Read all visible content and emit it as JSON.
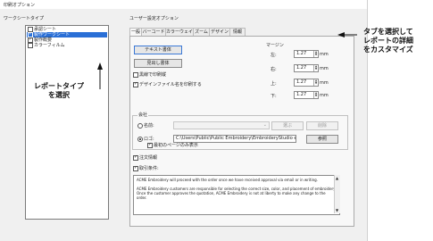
{
  "window_title": "印刷オプション",
  "report_types": {
    "label": "ワークシートタイプ",
    "items": [
      {
        "label": "承認シート",
        "checked": false,
        "selected": false
      },
      {
        "label": "製作ワークシート",
        "checked": true,
        "selected": true
      },
      {
        "label": "製作概要",
        "checked": true,
        "selected": false
      },
      {
        "label": "カラーフィルム",
        "checked": false,
        "selected": false
      }
    ]
  },
  "options": {
    "label": "ユーザー設定オプション",
    "tabs": [
      "一般",
      "バーコード",
      "カラーウェイ",
      "ズーム",
      "デザイン",
      "情報"
    ],
    "active_tab": "一般",
    "text_font_button": "テキスト書体",
    "heading_font_button": "見出し書体",
    "print_black_white": "黒線で印刷縦",
    "print_filename": "デザインファイル名を印刷する",
    "margins": {
      "label": "マージン",
      "left_label": "左:",
      "left_value": "1.27",
      "right_label": "右:",
      "right_value": "1.27",
      "top_label": "上:",
      "top_value": "1.27",
      "bottom_label": "下:",
      "bottom_value": "1.27",
      "unit": "mm"
    },
    "company": {
      "label": "会社",
      "name_label": "名前:",
      "name_value": "",
      "select_button": "選ぶ",
      "delete_button": "削除",
      "logo_label": "ロゴ:",
      "logo_path": "C:\\Users\\Public\\Public Embroidery\\EmbroideryStudio e4\\",
      "browse_button": "参照",
      "first_page_only": "最初のページのみ表示"
    },
    "order_notes": "注文情報",
    "terms_label": "取引条件:",
    "terms_text": "ACME Embroidery will proceed with the order once we have received approval via email or in writing.\n\nACME Embroidery customers are responsible for selecting the correct size, color, and placement of embroidery. Once the customer approves the quotation, ACME Embroidery is not at liberty to make any change to the order."
  },
  "annotations": {
    "right_callout": "タブを選択して\nレポートの詳細\nをカスタマイズ",
    "left_callout": "レポートタイプ\nを選択"
  }
}
